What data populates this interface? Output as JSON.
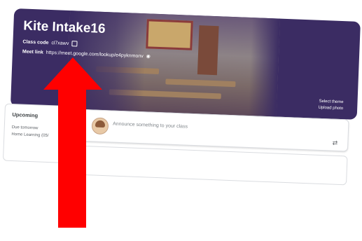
{
  "banner": {
    "class_name": "Kite Intake16",
    "class_code_label": "Class code",
    "class_code_value": "cl7xawv",
    "meet_link_label": "Meet link",
    "meet_link_value": "https://meet.google.com/lookup/e4pyknmonv",
    "select_theme": "Select theme",
    "upload_photo": "Upload photo"
  },
  "upcoming": {
    "heading": "Upcoming",
    "due": "Due tomorrow",
    "item": "Home Learning (05/"
  },
  "announce": {
    "placeholder": "Announce something to your class"
  },
  "colors": {
    "banner": "#3b2c63",
    "arrow": "#ff0000"
  },
  "icons": {
    "copy": "fullscreen-icon",
    "meet_toggle": "visibility-icon",
    "repost": "repost-icon"
  }
}
